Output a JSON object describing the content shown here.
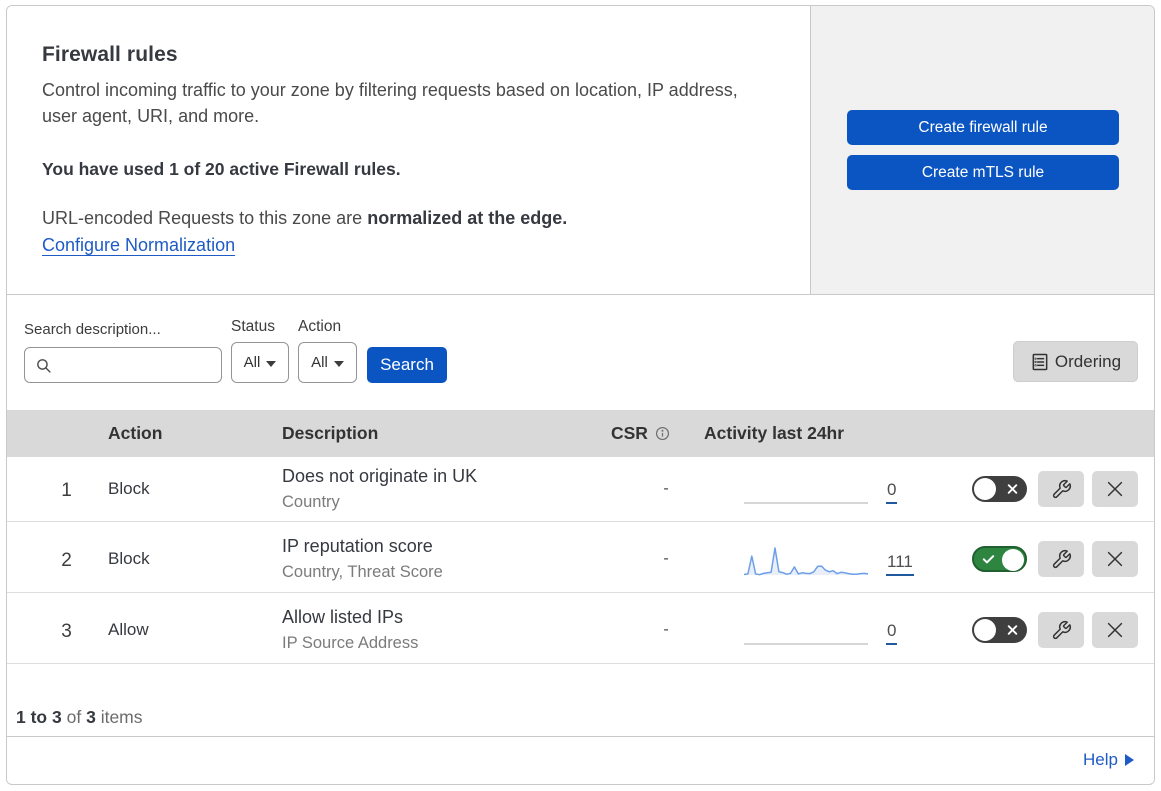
{
  "hero": {
    "title": "Firewall rules",
    "description_line1": "Control incoming traffic to your zone by filtering requests based on location, IP address,",
    "description_line2": "user agent, URI, and more.",
    "usage_text": "You have used 1 of 20 active Firewall rules.",
    "normalization_text": "URL-encoded Requests to this zone are",
    "normalization_bold": "normalized at the edge.",
    "normalization_link": "Configure Normalization",
    "create_firewall_rule_label": "Create firewall rule",
    "create_mtls_rule_label": "Create mTLS rule"
  },
  "filters": {
    "search_label": "Search description...",
    "search_value": "",
    "status_label": "Status",
    "status_value": "All",
    "action_label": "Action",
    "action_value": "All",
    "search_button_label": "Search",
    "ordering_button_label": "Ordering"
  },
  "table": {
    "headers": {
      "action": "Action",
      "description": "Description",
      "csr": "CSR",
      "activity": "Activity last 24hr"
    },
    "rows": [
      {
        "index": "1",
        "action": "Block",
        "title": "Does not originate in UK",
        "subtitle": "Country",
        "csr": "-",
        "activity_count": "0",
        "enabled": false
      },
      {
        "index": "2",
        "action": "Block",
        "title": "IP reputation score",
        "subtitle": "Country, Threat Score",
        "csr": "-",
        "activity_count": "111",
        "enabled": true
      },
      {
        "index": "3",
        "action": "Allow",
        "title": "Allow listed IPs",
        "subtitle": "IP Source Address",
        "csr": "-",
        "activity_count": "0",
        "enabled": false
      }
    ]
  },
  "footer": {
    "range": "1 to 3",
    "of": "of",
    "total": "3",
    "items": "items",
    "help_label": "Help"
  },
  "chart_data": {
    "type": "area",
    "title": "Activity last 24hr sparkline (rule 2: IP reputation score)",
    "total_requests": 111,
    "x_range": "last 24 hours",
    "values": [
      2,
      4,
      70,
      4,
      1,
      6,
      8,
      10,
      100,
      12,
      9,
      3,
      6,
      30,
      4,
      8,
      6,
      5,
      12,
      32,
      33,
      18,
      12,
      16,
      5,
      10,
      8,
      5,
      3,
      3,
      5,
      6,
      4
    ],
    "line_color": "#6d9fe8",
    "fill_color": "#e9eef8",
    "flat_line_color": "#c9c9c9"
  },
  "colors": {
    "accent_blue": "#0b55c3",
    "link_blue": "#1f5bc5",
    "toggle_on_green": "#2e8540",
    "toggle_off_gray": "#3f3f3f",
    "header_gray": "#d9d9d9",
    "panel_gray": "#f1f1f1"
  }
}
